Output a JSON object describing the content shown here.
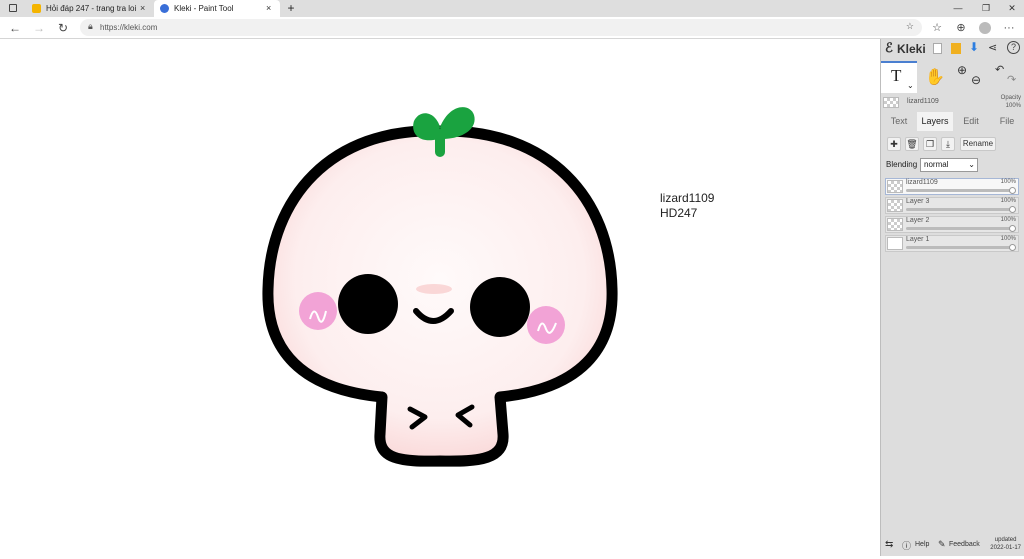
{
  "browser": {
    "tabs": [
      {
        "title": "Hỏi đáp 247 - trang tra loi",
        "active": false
      },
      {
        "title": "Kleki - Paint Tool",
        "active": true
      }
    ],
    "url": "https://kleki.com",
    "new_tab": "+",
    "tab_close": "×"
  },
  "canvas": {
    "text_line1": "lizard1109",
    "text_line2": "HD247",
    "colors": {
      "outline": "#000000",
      "face": "#fdeeee",
      "blush": "#f2a3d6",
      "sprout": "#1aa340"
    }
  },
  "panel": {
    "logo": "Kleki",
    "brush_layer_name": "lizard1109",
    "opacity_label": "Opacity",
    "opacity_value": "100%",
    "tabs": [
      "Text",
      "Layers",
      "Edit",
      "File"
    ],
    "active_tab": "Layers",
    "rename_label": "Rename",
    "blending_label": "Blending",
    "blending_value": "normal",
    "layers": [
      {
        "name": "lizard1109",
        "opacity": "100%",
        "selected": true
      },
      {
        "name": "Layer 3",
        "opacity": "100%",
        "selected": false
      },
      {
        "name": "Layer 2",
        "opacity": "100%",
        "selected": false
      },
      {
        "name": "Layer 1",
        "opacity": "100%",
        "selected": false
      }
    ],
    "footer": {
      "help": "Help",
      "feedback": "Feedback",
      "updated_label": "updated",
      "updated_date": "2022-01-17"
    },
    "accent": "#4a7fd0"
  }
}
